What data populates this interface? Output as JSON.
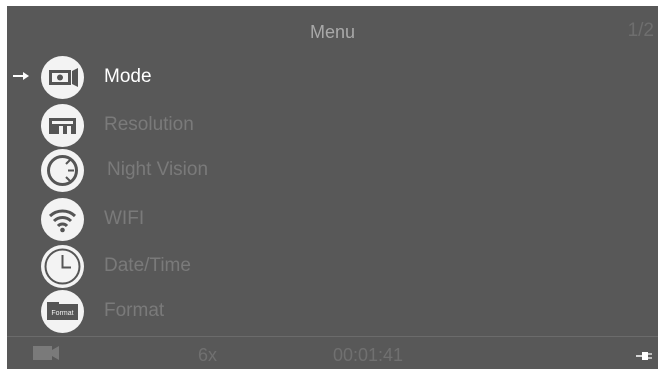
{
  "header": {
    "title": "Menu",
    "page_indicator": "1/2"
  },
  "menu": {
    "items": [
      {
        "label": "Mode",
        "icon": "camera-mode-icon",
        "selected": true
      },
      {
        "label": "Resolution",
        "icon": "resolution-icon",
        "selected": false
      },
      {
        "label": "Night Vision",
        "icon": "night-vision-icon",
        "selected": false
      },
      {
        "label": "WIFI",
        "icon": "wifi-icon",
        "selected": false
      },
      {
        "label": "Date/Time",
        "icon": "clock-icon",
        "selected": false
      },
      {
        "label": "Format",
        "icon": "format-icon",
        "icon_text": "Format",
        "selected": false
      }
    ]
  },
  "status": {
    "mode_icon": "video-camera-icon",
    "zoom": "6x",
    "timer": "00:01:41",
    "power_icon": "power-plug-icon"
  },
  "colors": {
    "background": "#585858",
    "selected_text": "#ffffff",
    "unselected_text": "#7a7a7a",
    "icon_circle": "#f3f3f3"
  }
}
